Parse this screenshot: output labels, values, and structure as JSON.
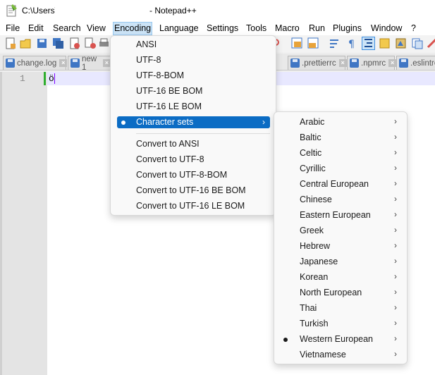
{
  "title": {
    "path_prefix": "C:\\Users\\",
    "app_suffix": "- Notepad++"
  },
  "menubar": [
    "File",
    "Edit",
    "Search",
    "View",
    "Encoding",
    "Language",
    "Settings",
    "Tools",
    "Macro",
    "Run",
    "Plugins",
    "Window",
    "?"
  ],
  "tabs": [
    "change.log",
    "new 1",
    ".prettierrc",
    ".npmrc",
    ".eslintrc"
  ],
  "editor": {
    "line_number": "1",
    "content": "ö"
  },
  "encoding_menu": {
    "items_top": [
      "ANSI",
      "UTF-8",
      "UTF-8-BOM",
      "UTF-16 BE BOM",
      "UTF-16 LE BOM"
    ],
    "highlighted": "Character sets",
    "items_bottom": [
      "Convert to ANSI",
      "Convert to UTF-8",
      "Convert to UTF-8-BOM",
      "Convert to UTF-16 BE BOM",
      "Convert to UTF-16 LE BOM"
    ]
  },
  "charset_menu": {
    "items": [
      "Arabic",
      "Baltic",
      "Celtic",
      "Cyrillic",
      "Central European",
      "Chinese",
      "Eastern European",
      "Greek",
      "Hebrew",
      "Japanese",
      "Korean",
      "North European",
      "Thai",
      "Turkish",
      "Western European",
      "Vietnamese"
    ],
    "checked": "Western European"
  },
  "colors": {
    "highlight": "#0b6cc4",
    "current_line": "#e8e8ff",
    "change_marker": "#2fae2f"
  }
}
